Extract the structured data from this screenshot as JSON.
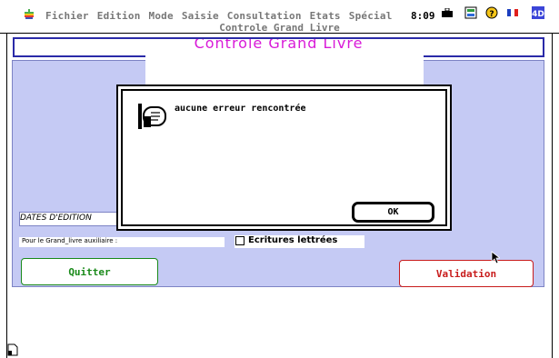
{
  "menubar": {
    "apple_icon": "apple-icon",
    "menus": [
      "Fichier",
      "Edition",
      "Mode",
      "Saisie",
      "Consultation",
      "Etats",
      "Spécial"
    ],
    "clock": "8:09",
    "right_icons": [
      "briefcase-icon",
      "network-icon",
      "help-icon",
      "french-flag-icon",
      "4d-icon"
    ]
  },
  "window": {
    "title": "Controle Grand Livre",
    "header_title": "Controle Grand Livre"
  },
  "form": {
    "dates_label": "DATES D'EDITION",
    "aux_label": "Pour le Grand_livre auxiliaire :",
    "ecritures_label": "Ecritures lettrées",
    "quit_label": "Quitter",
    "validate_label": "Validation"
  },
  "dialog": {
    "message": "aucune erreur rencontrée",
    "ok_label": "OK",
    "icon": "note-icon"
  },
  "colors": {
    "panel": "#c5caf4",
    "title_magenta": "#d81ad8",
    "title_border": "#2a2aa8",
    "quit_green": "#1a8a1a",
    "validate_red": "#c81c1c"
  }
}
